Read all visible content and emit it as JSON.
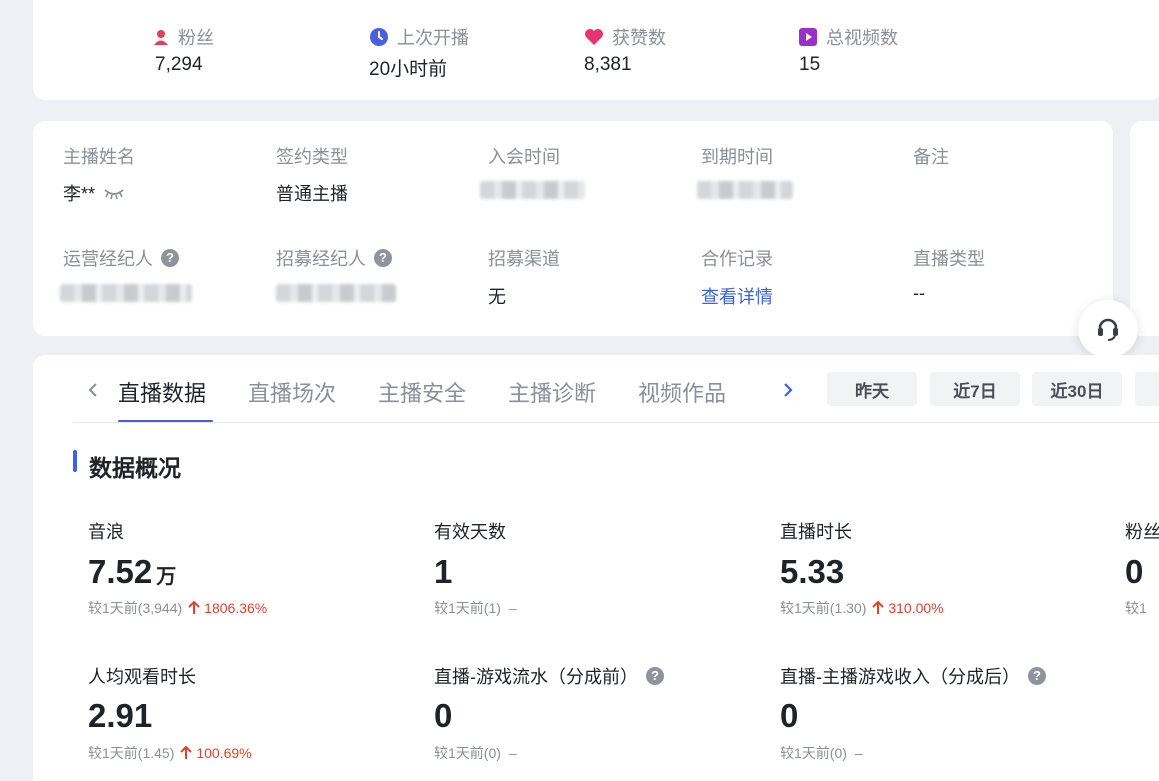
{
  "stats": [
    {
      "icon": "fans-icon",
      "label": "粉丝",
      "value": "7,294"
    },
    {
      "icon": "clock-icon",
      "label": "上次开播",
      "value": "20小时前"
    },
    {
      "icon": "heart-icon",
      "label": "获赞数",
      "value": "8,381"
    },
    {
      "icon": "video-icon",
      "label": "总视频数",
      "value": "15"
    }
  ],
  "info": {
    "host_name_label": "主播姓名",
    "host_name_value": "李**",
    "contract_type_label": "签约类型",
    "contract_type_value": "普通主播",
    "join_time_label": "入会时间",
    "expire_time_label": "到期时间",
    "remark_label": "备注",
    "ops_agent_label": "运营经纪人",
    "recruit_agent_label": "招募经纪人",
    "recruit_channel_label": "招募渠道",
    "recruit_channel_value": "无",
    "coop_record_label": "合作记录",
    "coop_record_link": "查看详情",
    "live_type_label": "直播类型",
    "live_type_value": "--"
  },
  "tabs": [
    "直播数据",
    "直播场次",
    "主播安全",
    "主播诊断",
    "视频作品"
  ],
  "range_buttons": [
    "昨天",
    "近7日",
    "近30日"
  ],
  "section_title": "数据概况",
  "metrics": [
    {
      "label": "音浪",
      "value": "7.52",
      "unit": "万",
      "compare": "较1天前(3,944)",
      "trend": "1806.36%"
    },
    {
      "label": "有效天数",
      "value": "1",
      "compare": "较1天前(1)",
      "trend_flat": "–"
    },
    {
      "label": "直播时长",
      "value": "5.33",
      "compare": "较1天前(1.30)",
      "trend": "310.00%"
    },
    {
      "label": "粉丝",
      "value": "0",
      "compare": "较1"
    },
    {
      "label": "人均观看时长",
      "value": "2.91",
      "compare": "较1天前(1.45)",
      "trend": "100.69%"
    },
    {
      "label": "直播-游戏流水（分成前）",
      "value": "0",
      "compare": "较1天前(0)",
      "trend_flat": "–"
    },
    {
      "label": "直播-主播游戏收入（分成后）",
      "value": "0",
      "compare": "较1天前(0)",
      "trend_flat": "–"
    }
  ],
  "colors": {
    "accent": "#3b63e0",
    "up": "#e0422e",
    "heart": "#e8336e",
    "video": "#9b2fc9",
    "fans": "#e0405e",
    "clock": "#4a5ee0"
  }
}
